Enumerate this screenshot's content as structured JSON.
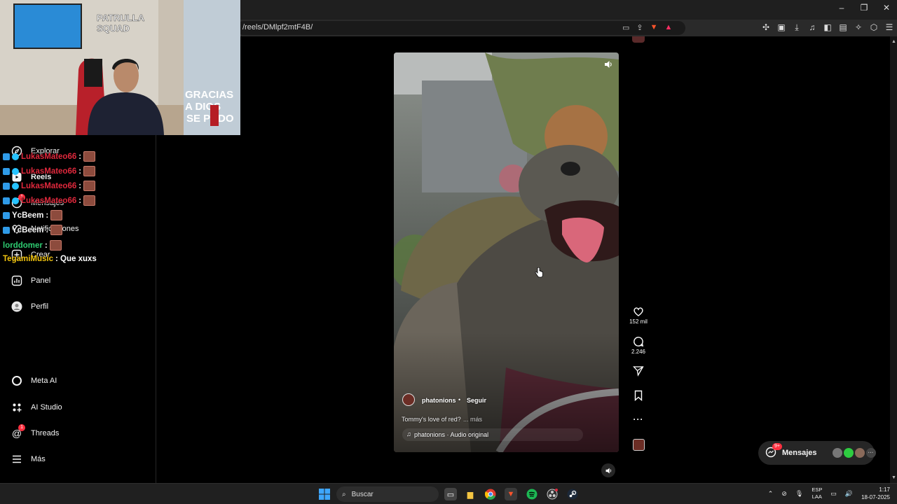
{
  "browser": {
    "url": "/reels/DMlpf2mtF4B/",
    "window_controls": [
      "–",
      "❐",
      "✕"
    ]
  },
  "sidebar": {
    "items": [
      {
        "label": "Explorar",
        "icon": "compass-icon"
      },
      {
        "label": "Reels",
        "icon": "reels-icon"
      },
      {
        "label": "Mensajes",
        "icon": "messenger-icon"
      },
      {
        "label": "Notificaciones",
        "icon": "heart-icon"
      },
      {
        "label": "Crear",
        "icon": "plus-square-icon"
      },
      {
        "label": "Panel",
        "icon": "chart-icon"
      },
      {
        "label": "Perfil",
        "icon": "avatar-icon"
      },
      {
        "label": "Meta AI",
        "icon": "meta-ai-icon"
      },
      {
        "label": "AI Studio",
        "icon": "ai-studio-icon"
      },
      {
        "label": "Threads",
        "icon": "threads-icon",
        "badge": "1"
      },
      {
        "label": "Más",
        "icon": "menu-icon"
      }
    ],
    "messages_badge": "1"
  },
  "stream_overlay": {
    "chat": [
      {
        "user": "LukasMateo66",
        "message": ":",
        "color": "#e0283c"
      },
      {
        "user": "LukasMateo66",
        "message": ":",
        "color": "#e0283c"
      },
      {
        "user": "LukasMateo66",
        "message": ":",
        "color": "#e0283c"
      },
      {
        "user": "LukasMateo66",
        "message": ":",
        "color": "#e0283c"
      },
      {
        "user": "YcBeem",
        "message": ":",
        "color": "#f5f5f5"
      },
      {
        "user": "YcBeem",
        "message": ":",
        "color": "#f5f5f5"
      },
      {
        "user": "lorddomer",
        "message": ":",
        "color": "#2ecc71"
      },
      {
        "user": "TegamiMusic",
        "message": ": Que xuxs",
        "color": "#f1c40f"
      }
    ],
    "webcam_sign": [
      "GRACIAS",
      "A DIOS",
      "SE PUDO"
    ],
    "webcam_banner": "SQUAD"
  },
  "reel": {
    "username": "phatonions",
    "separator": "•",
    "follow_label": "Seguir",
    "caption": "Tommy's love of red?",
    "more_label": "... más",
    "audio": "phatonions · Audio original",
    "likes": "152 mil",
    "comments": "2.246"
  },
  "floating_messages": {
    "label": "Mensajes",
    "badge": "9+"
  },
  "taskbar": {
    "search_placeholder": "Buscar",
    "lang_top": "ESP",
    "lang_bottom": "LAA",
    "time": "1:17",
    "date": "18-07-2025"
  },
  "colors": {
    "accent_red": "#ff3040",
    "brave": "#fb542b",
    "spotify": "#1db954"
  }
}
